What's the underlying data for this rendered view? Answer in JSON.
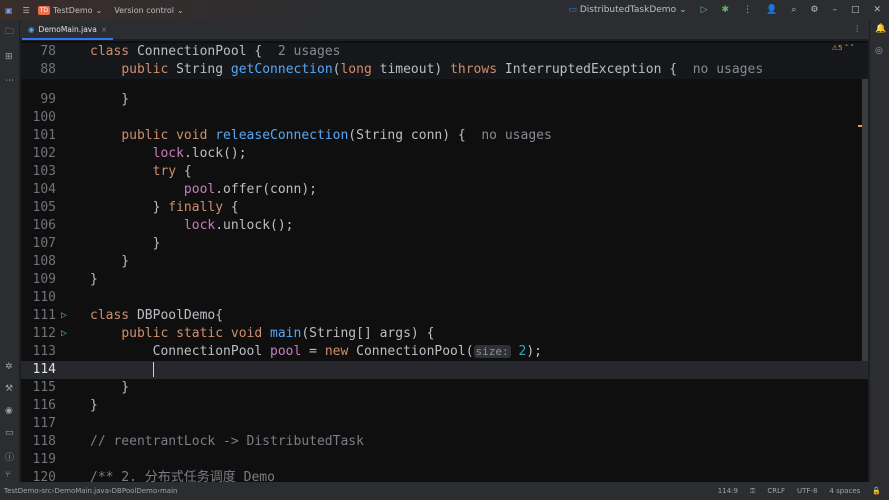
{
  "titlebar": {
    "project_initials": "TD",
    "project": "TestDemo",
    "vcs": "Version control",
    "run_config": "DistributedTaskDemo"
  },
  "tab": {
    "label": "DemoMain.java"
  },
  "inspection": {
    "warnings": "5"
  },
  "lines": [
    {
      "n": "78",
      "html": "<span class='kw'>class</span> ConnectionPool {  <span class='hint'>2 usages</span>",
      "sticky": true
    },
    {
      "n": "88",
      "html": "    <span class='kw'>public</span> String <span class='fn'>getConnection</span>(<span class='kw'>long</span> timeout) <span class='kw'>throws</span> InterruptedException {  <span class='hint'>no usages</span>",
      "sticky": true
    },
    {
      "n": "99",
      "html": "    }"
    },
    {
      "n": "100",
      "html": ""
    },
    {
      "n": "101",
      "html": "    <span class='kw'>public void</span> <span class='fn'>releaseConnection</span>(String conn) {  <span class='hint'>no usages</span>"
    },
    {
      "n": "102",
      "html": "        <span class='fld'>lock</span>.lock();"
    },
    {
      "n": "103",
      "html": "        <span class='kw'>try</span> {"
    },
    {
      "n": "104",
      "html": "            <span class='fld'>pool</span>.offer(conn);"
    },
    {
      "n": "105",
      "html": "        } <span class='kw'>finally</span> {"
    },
    {
      "n": "106",
      "html": "            <span class='fld'>lock</span>.unlock();"
    },
    {
      "n": "107",
      "html": "        }"
    },
    {
      "n": "108",
      "html": "    }"
    },
    {
      "n": "109",
      "html": "}"
    },
    {
      "n": "110",
      "html": ""
    },
    {
      "n": "111",
      "html": "<span class='kw'>class</span> DBPoolDemo{",
      "run": true
    },
    {
      "n": "112",
      "html": "    <span class='kw'>public static void</span> <span class='fn'>main</span>(String[] args) {",
      "run": true
    },
    {
      "n": "113",
      "html": "        ConnectionPool <span class='fld'>pool</span> = <span class='kw'>new</span> ConnectionPool(<span class='ih'>size:</span> <span class='num'>2</span>);"
    },
    {
      "n": "114",
      "html": "        <span class='caret'></span>",
      "current": true
    },
    {
      "n": "115",
      "html": "    }"
    },
    {
      "n": "116",
      "html": "}"
    },
    {
      "n": "117",
      "html": ""
    },
    {
      "n": "118",
      "html": "<span class='cm'>// reentrantLock -&gt; DistributedTask</span>"
    },
    {
      "n": "119",
      "html": ""
    },
    {
      "n": "120",
      "html": "<span class='cm'>/** 2. 分布式任务调度 Demo</span>"
    }
  ],
  "status": {
    "breadcrumb": [
      "TestDemo",
      "src",
      "DemoMain.java",
      "DBPoolDemo",
      "main"
    ],
    "position": "114:9",
    "line_sep": "CRLF",
    "encoding": "UTF-8",
    "indent": "4 spaces"
  }
}
